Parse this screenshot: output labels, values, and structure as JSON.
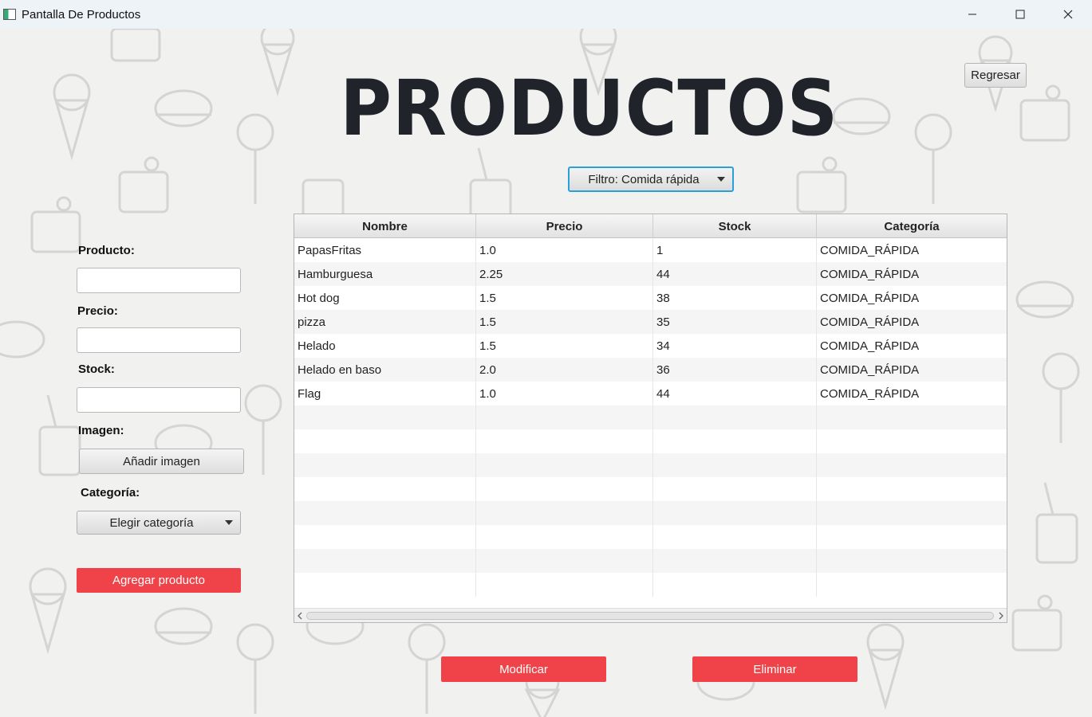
{
  "window": {
    "title": "Pantalla De Productos",
    "controls": [
      "minimize-icon",
      "maximize-icon",
      "close-icon"
    ]
  },
  "header": {
    "heading": "PRODUCTOS",
    "back_button": "Regresar",
    "filter_label": "Filtro: Comida rápida"
  },
  "form": {
    "product_label": "Producto:",
    "product_value": "",
    "price_label": "Precio:",
    "price_value": "",
    "stock_label": "Stock:",
    "stock_value": "",
    "image_label": "Imagen:",
    "add_image_button": "Añadir imagen",
    "category_label": "Categoría:",
    "category_select": "Elegir categoría",
    "add_product_button": "Agregar producto"
  },
  "table": {
    "columns": [
      "Nombre",
      "Precio",
      "Stock",
      "Categoría"
    ],
    "rows": [
      [
        "PapasFritas",
        "1.0",
        "1",
        "COMIDA_RÁPIDA"
      ],
      [
        "Hamburguesa",
        "2.25",
        "44",
        "COMIDA_RÁPIDA"
      ],
      [
        "Hot dog",
        "1.5",
        "38",
        "COMIDA_RÁPIDA"
      ],
      [
        "pizza",
        "1.5",
        "35",
        "COMIDA_RÁPIDA"
      ],
      [
        "Helado",
        "1.5",
        "34",
        "COMIDA_RÁPIDA"
      ],
      [
        "Helado en baso",
        "2.0",
        "36",
        "COMIDA_RÁPIDA"
      ],
      [
        "Flag",
        "1.0",
        "44",
        "COMIDA_RÁPIDA"
      ]
    ],
    "empty_rows": 8
  },
  "actions": {
    "modify_button": "Modificar",
    "delete_button": "Eliminar"
  },
  "colors": {
    "accent_red": "#ef4349",
    "focus_blue": "#2a9fd8",
    "heading": "#20242a"
  }
}
